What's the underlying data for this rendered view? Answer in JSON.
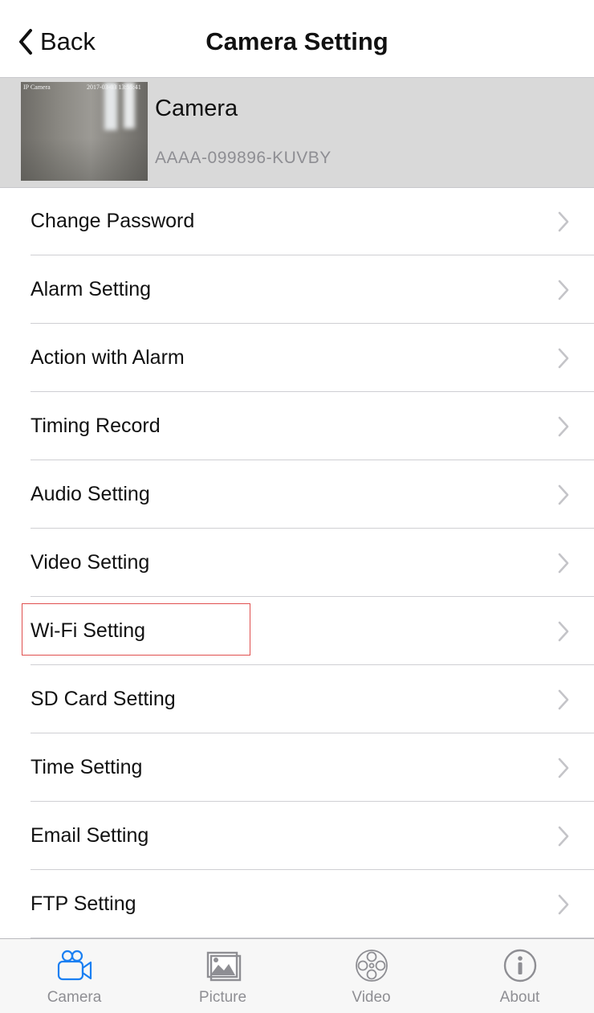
{
  "nav": {
    "back_label": "Back",
    "title": "Camera Setting"
  },
  "device": {
    "name": "Camera",
    "id": "AAAA-099896-KUVBY",
    "thumb_osd_name": "IP Camera",
    "thumb_osd_time": "2017-03-03 13:55:41"
  },
  "settings": [
    {
      "label": "Change Password"
    },
    {
      "label": "Alarm Setting"
    },
    {
      "label": "Action with Alarm"
    },
    {
      "label": "Timing Record"
    },
    {
      "label": "Audio Setting"
    },
    {
      "label": "Video Setting"
    },
    {
      "label": "Wi-Fi Setting"
    },
    {
      "label": "SD Card Setting"
    },
    {
      "label": "Time Setting"
    },
    {
      "label": "Email Setting"
    },
    {
      "label": "FTP Setting"
    }
  ],
  "highlighted_setting": "Wi-Fi Setting",
  "tabs": [
    {
      "label": "Camera",
      "icon": "camera-icon",
      "active": true
    },
    {
      "label": "Picture",
      "icon": "picture-icon",
      "active": false
    },
    {
      "label": "Video",
      "icon": "film-reel-icon",
      "active": false
    },
    {
      "label": "About",
      "icon": "info-icon",
      "active": false
    }
  ],
  "colors": {
    "accent": "#1a7ff2",
    "inactive": "#8e8e93",
    "highlight_border": "#e0504f",
    "header_bg": "#d9d9d9"
  }
}
